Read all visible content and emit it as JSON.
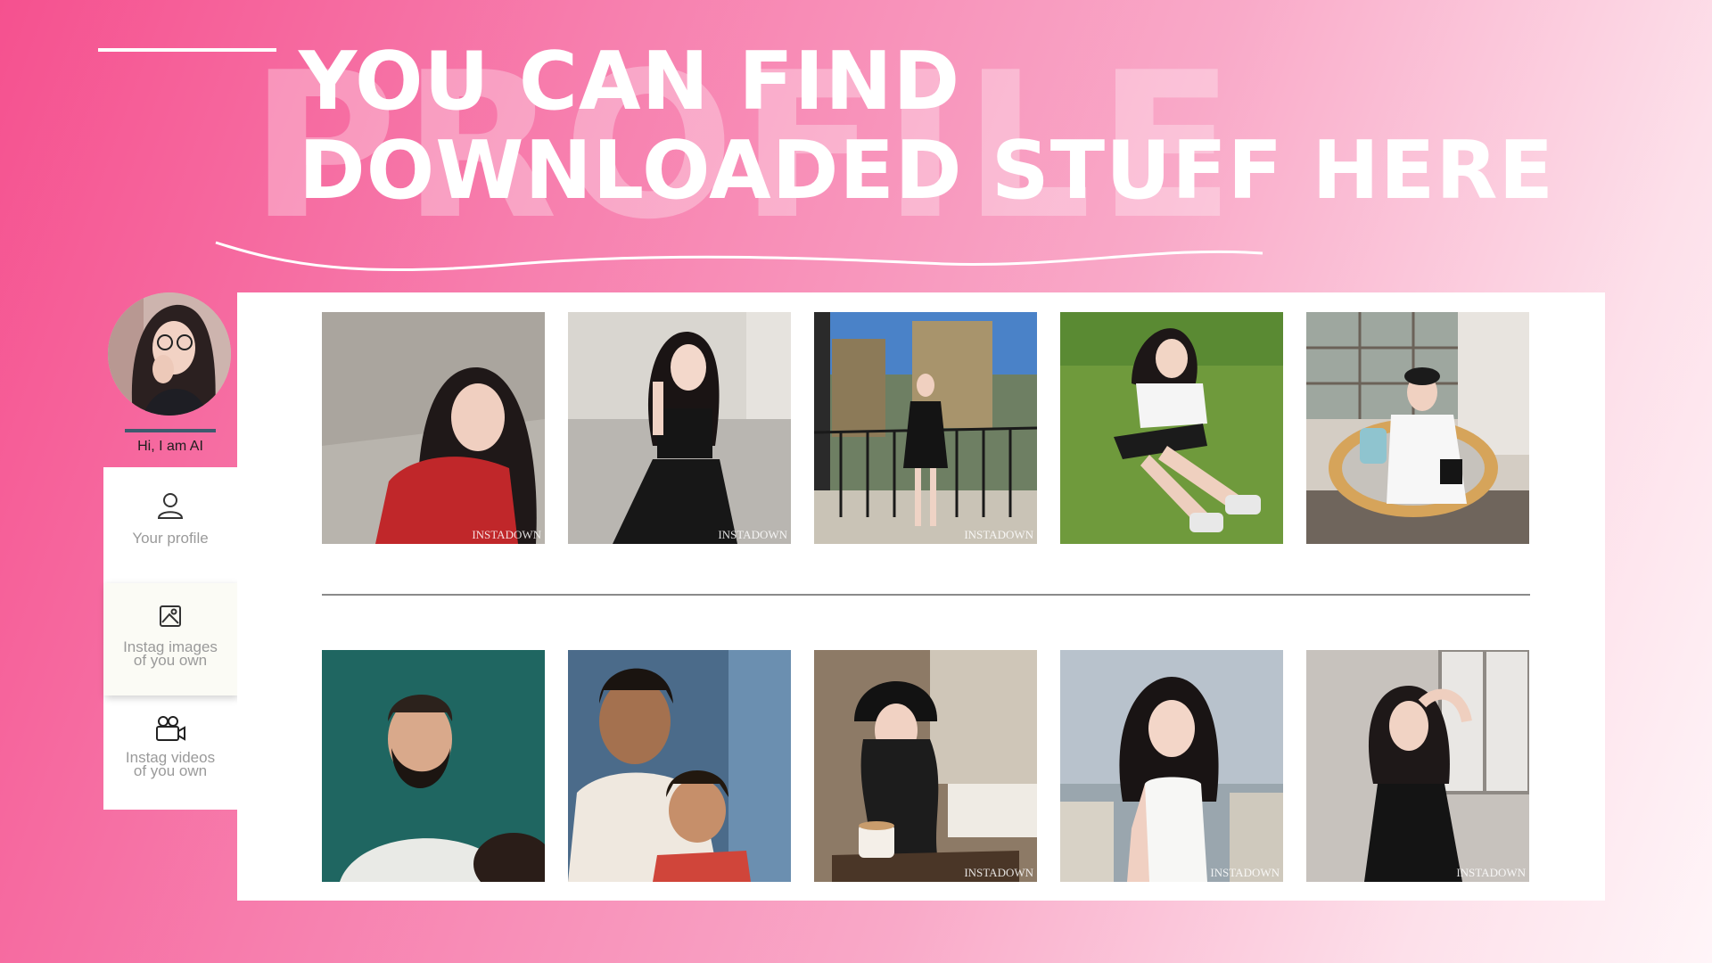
{
  "header": {
    "watermark": "PROFILE",
    "headline_line1": "YOU CAN FIND",
    "headline_line2": "DOWNLOADED STUFF HERE"
  },
  "profile": {
    "greeting": "Hi, I am AI"
  },
  "sidebar": {
    "items": [
      {
        "icon": "user-icon",
        "label": "Your profile",
        "active": false
      },
      {
        "icon": "image-icon",
        "label_line1": "Instag images",
        "label_line2": "of you own",
        "active": true
      },
      {
        "icon": "video-camera-icon",
        "label_line1": "Instag videos",
        "label_line2": "of you own",
        "active": false
      }
    ]
  },
  "gallery": {
    "watermark_text": "INSTADOWN",
    "row1": [
      {
        "name": "photo-girl-red-shirt"
      },
      {
        "name": "photo-girl-black-top"
      },
      {
        "name": "photo-girl-balcony"
      },
      {
        "name": "photo-girl-grass"
      },
      {
        "name": "photo-girl-white-dress"
      }
    ],
    "row2": [
      {
        "name": "photo-bearded-man"
      },
      {
        "name": "photo-man-with-child"
      },
      {
        "name": "photo-girl-cafe"
      },
      {
        "name": "photo-girl-city"
      },
      {
        "name": "photo-girl-window"
      }
    ]
  },
  "colors": {
    "background_start": "#f5518f",
    "background_end": "#fff5f8",
    "panel": "#ffffff",
    "avatar_underline": "#3e5a6e"
  }
}
